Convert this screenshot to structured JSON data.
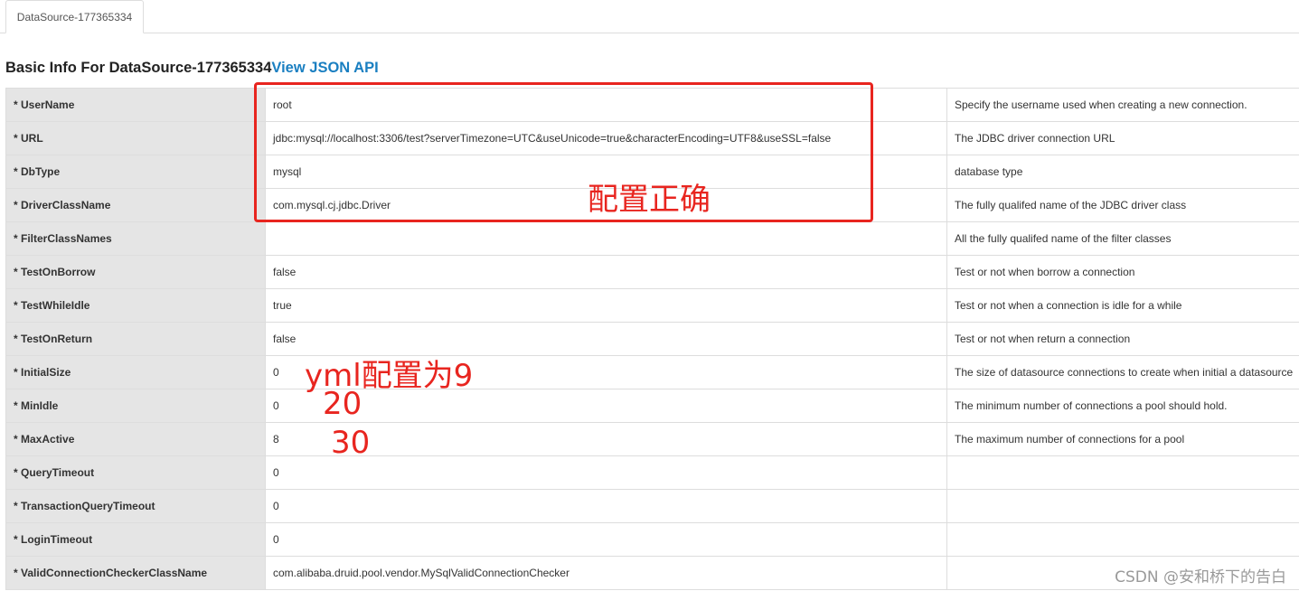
{
  "tab": {
    "label": "DataSource-177365334"
  },
  "heading": {
    "title": "Basic Info For DataSource-177365334",
    "link": "View JSON API"
  },
  "rows": [
    {
      "key": "* UserName",
      "value": "root",
      "desc": "Specify the username used when creating a new connection."
    },
    {
      "key": "* URL",
      "value": "jdbc:mysql://localhost:3306/test?serverTimezone=UTC&useUnicode=true&characterEncoding=UTF8&useSSL=false",
      "desc": "The JDBC driver connection URL"
    },
    {
      "key": "* DbType",
      "value": "mysql",
      "desc": "database type"
    },
    {
      "key": "* DriverClassName",
      "value": "com.mysql.cj.jdbc.Driver",
      "desc": "The fully qualifed name of the JDBC driver class"
    },
    {
      "key": "* FilterClassNames",
      "value": "",
      "desc": "All the fully qualifed name of the filter classes"
    },
    {
      "key": "* TestOnBorrow",
      "value": "false",
      "desc": "Test or not when borrow a connection"
    },
    {
      "key": "* TestWhileIdle",
      "value": "true",
      "desc": "Test or not when a connection is idle for a while"
    },
    {
      "key": "* TestOnReturn",
      "value": "false",
      "desc": "Test or not when return a connection"
    },
    {
      "key": "* InitialSize",
      "value": "0",
      "desc": "The size of datasource connections to create when initial a datasource"
    },
    {
      "key": "* MinIdle",
      "value": "0",
      "desc": "The minimum number of connections a pool should hold."
    },
    {
      "key": "* MaxActive",
      "value": "8",
      "desc": "The maximum number of connections for a pool"
    },
    {
      "key": "* QueryTimeout",
      "value": "0",
      "desc": ""
    },
    {
      "key": "* TransactionQueryTimeout",
      "value": "0",
      "desc": ""
    },
    {
      "key": "* LoginTimeout",
      "value": "0",
      "desc": ""
    },
    {
      "key": "* ValidConnectionCheckerClassName",
      "value": "com.alibaba.druid.pool.vendor.MySqlValidConnectionChecker",
      "desc": ""
    }
  ],
  "annotations": {
    "correct": "配置正确",
    "yml": "yml配置为9",
    "twenty": "20",
    "thirty": "30"
  },
  "watermark": "CSDN @安和桥下的告白",
  "colors": {
    "annotation": "#e8251f",
    "link": "#1a7fc1",
    "key_bg": "#e5e5e5"
  }
}
